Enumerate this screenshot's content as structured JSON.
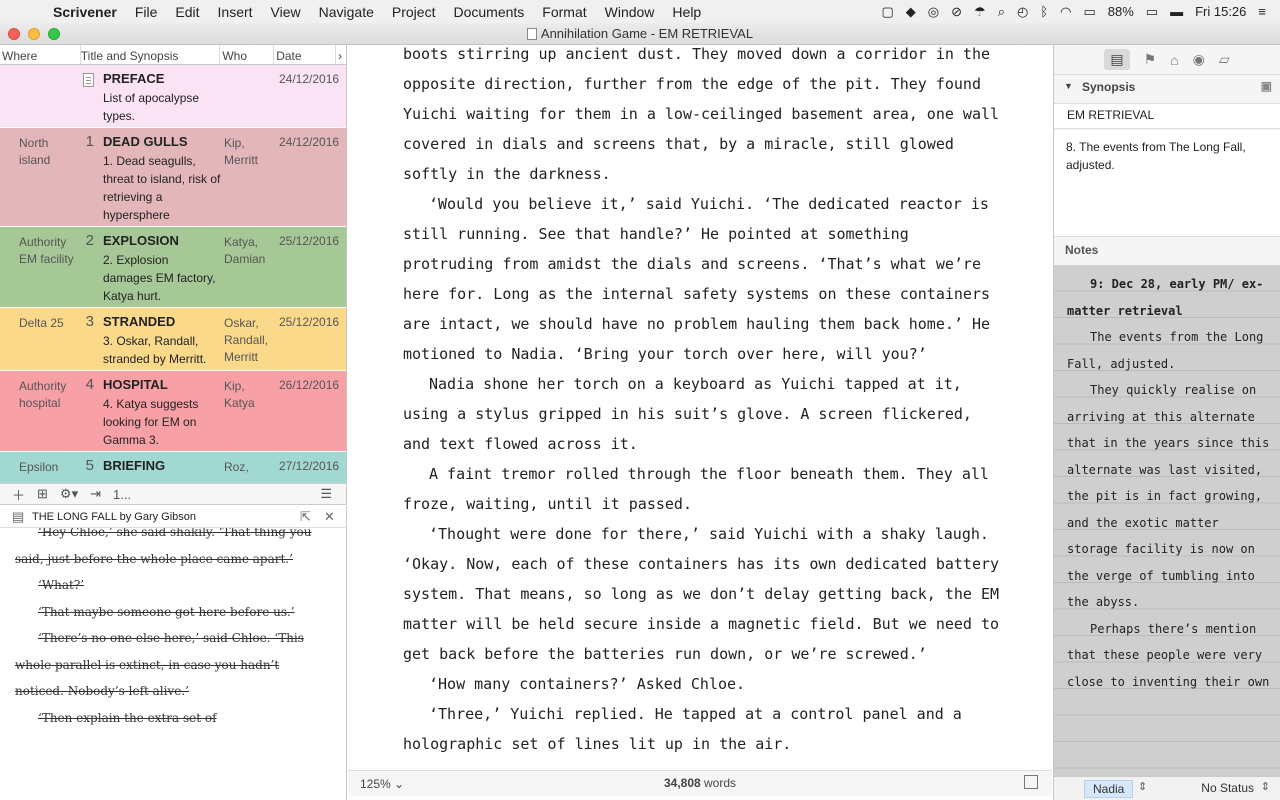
{
  "menubar": {
    "app": "Scrivener",
    "items": [
      "File",
      "Edit",
      "Insert",
      "View",
      "Navigate",
      "Project",
      "Documents",
      "Format",
      "Window",
      "Help"
    ],
    "battery": "88%",
    "clock": "Fri 15:26"
  },
  "window": {
    "title": "Annihilation Game - EM RETRIEVAL"
  },
  "outliner": {
    "headers": {
      "where": "Where",
      "title": "Title and Synopsis",
      "who": "Who",
      "date": "Date"
    },
    "rows": [
      {
        "where": "",
        "num": "",
        "title": "PREFACE",
        "synopsis": "List of apocalypse types.",
        "who": "",
        "date": "24/12/2016",
        "color": "#fbe3f6",
        "doc": true
      },
      {
        "where": "North island",
        "num": "1",
        "title": "DEAD GULLS",
        "synopsis": "1. Dead seagulls, threat to island, risk of retrieving a hypersphere",
        "who": "Kip, Merritt",
        "date": "24/12/2016",
        "color": "#e3b6ba",
        "doc": false
      },
      {
        "where": "Authority EM facility",
        "num": "2",
        "title": "EXPLOSION",
        "synopsis": "2. Explosion damages EM factory, Katya hurt.",
        "who": "Katya, Damian",
        "date": "25/12/2016",
        "color": "#a6c896",
        "doc": false
      },
      {
        "where": "Delta 25",
        "num": "3",
        "title": "STRANDED",
        "synopsis": "3. Oskar, Randall, stranded by Merritt.",
        "who": "Oskar, Randall, Merritt",
        "date": "25/12/2016",
        "color": "#fbd98b",
        "doc": false
      },
      {
        "where": "Authority hospital",
        "num": "4",
        "title": "HOSPITAL",
        "synopsis": "4. Katya suggests looking for EM on Gamma 3.",
        "who": "Kip, Katya",
        "date": "26/12/2016",
        "color": "#f7a0a6",
        "doc": false
      },
      {
        "where": "Epsilon",
        "num": "5",
        "title": "BRIEFING",
        "synopsis": "",
        "who": "Roz,",
        "date": "27/12/2016",
        "color": "#a2d8d2",
        "doc": false
      }
    ],
    "toolbar_count": "1..."
  },
  "quickref": {
    "title": "THE LONG FALL by Gary Gibson",
    "paragraphs": [
      "‘Hey Chloe,’ she said shakily. ‘That thing you said, just before the whole place came apart.’",
      "‘What?’",
      "‘That maybe someone got here before us.’",
      "‘There’s no one else here,’ said Chloe. ‘This whole parallel is extinct, in case you hadn’t noticed. Nobody’s left alive.’",
      "‘Then explain the extra set of"
    ]
  },
  "editor": {
    "paragraphs": [
      {
        "indent": false,
        "text": "boots stirring up ancient dust. They moved down a corridor in the opposite direction, further from the edge of the pit. They found Yuichi waiting for them in a low-ceilinged basement area, one wall covered in dials and screens that, by a miracle, still glowed softly in the darkness."
      },
      {
        "indent": true,
        "text": "‘Would you believe it,’ said Yuichi. ‘The dedicated reactor is still running. See that handle?’ He pointed at something protruding from amidst the dials and screens. ‘That’s what we’re here for. Long as the internal safety systems on these containers are intact, we should have no problem hauling them back home.’ He motioned to Nadia. ‘Bring your torch over here, will you?’"
      },
      {
        "indent": true,
        "text": "Nadia shone her torch on a keyboard as Yuichi tapped at it, using a stylus gripped in his suit’s glove. A screen flickered, and text flowed across it."
      },
      {
        "indent": true,
        "text": "A faint tremor rolled through the floor beneath them. They all froze, waiting, until it passed."
      },
      {
        "indent": true,
        "text": "‘Thought were done for there,’ said Yuichi with a shaky laugh. ‘Okay. Now, each of these containers has its own dedicated battery system. That means, so long as we don’t delay getting back, the EM matter will be held secure inside a magnetic field. But we need to get back before the batteries run down, or we’re screwed.’"
      },
      {
        "indent": true,
        "text": "‘How many containers?’ Asked Chloe."
      },
      {
        "indent": true,
        "text": "‘Three,’ Yuichi replied. He tapped at a control panel and a holographic set of lines lit up in the air."
      }
    ],
    "zoom": "125%",
    "word_count": "34,808",
    "words_label": "words"
  },
  "inspector": {
    "synopsis_label": "Synopsis",
    "synopsis_title": "EM RETRIEVAL",
    "synopsis_text": "8. The events from The Long Fall, adjusted.",
    "notes_label": "Notes",
    "notes": [
      {
        "bold": true,
        "text": "9: Dec 28, early PM/ ex-matter retrieval"
      },
      {
        "bold": false,
        "text": "The events from the Long Fall, adjusted."
      },
      {
        "bold": false,
        "text": "They quickly realise on arriving at this alternate that in the years since this alternate was last visited, the pit is in fact growing, and the exotic matter storage facility is now on the verge of tumbling into the abyss."
      },
      {
        "bold": false,
        "text": "Perhaps there’s mention that these people were very close to inventing their own"
      }
    ],
    "label_value": "Nadia",
    "status_value": "No Status"
  }
}
